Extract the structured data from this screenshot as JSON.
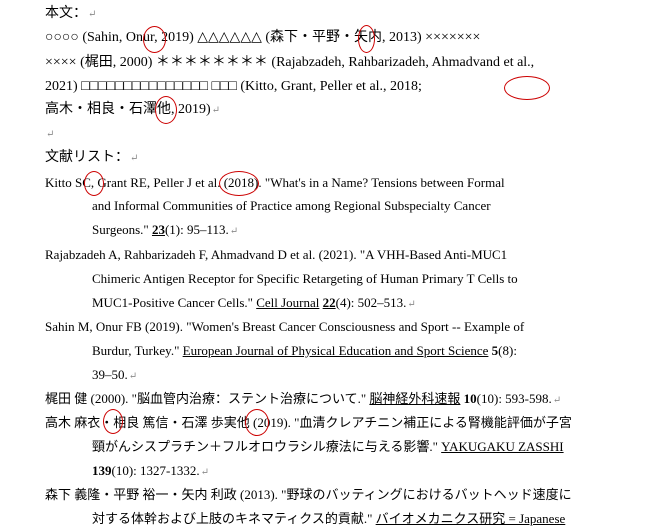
{
  "body": {
    "heading": "本文：",
    "lines": [
      "○○○○ (Sahin, Onur, 2019) △△△△△△ (森下・平野・矢内, 2013)  ×××××××",
      "×××× (梶田, 2000)  ＊＊＊＊＊＊＊＊ (Rajabzadeh, Rahbarizadeh, Ahmadvand et al.,",
      "2021) □□□□□□□□□□□□□□□  □□□ (Kitto, Grant, Peller et al., 2018;",
      "高木・相良・石澤他, 2019)"
    ]
  },
  "references": {
    "heading": "文献リスト：",
    "kitto": {
      "line1": "Kitto SC, Grant RE, Peller J et al. (2018). \"What's in a Name? Tensions between Formal",
      "line2": "and Informal Communities of Practice among Regional Subspecialty Cancer",
      "line3_pre": "Surgeons.\"  ",
      "line3_vol": "23",
      "line3_post": "(1): 95–113."
    },
    "rajab": {
      "line1": "Rajabzadeh A, Rahbarizadeh F, Ahmadvand D et al. (2021). \"A VHH-Based Anti-MUC1",
      "line2": "Chimeric Antigen Receptor for Specific Retargeting of Human Primary T Cells to",
      "line3_pre": "MUC1-Positive Cancer Cells.\" ",
      "line3_journal": "Cell Journal",
      "line3_vol": "22",
      "line3_post": "(4): 502–513."
    },
    "sahin": {
      "line1": "Sahin M, Onur FB (2019). \"Women's Breast Cancer Consciousness and Sport -- Example of",
      "line2_pre": "Burdur, Turkey.\" ",
      "line2_journal": "European Journal of Physical Education and Sport Science",
      "line2_vol": "5",
      "line2_post": "(8):",
      "line3": "39–50."
    },
    "kajita": {
      "pre": "梶田  健 (2000). \"脳血管内治療：ステント治療について.\" ",
      "journal": "脳神経外科速報",
      "vol": "10",
      "post": "(10): 593-598."
    },
    "takagi": {
      "line1": "高木  麻衣・相良  篤信・石澤  歩実他 (2019). \"血清クレアチニン補正による腎機能評価が子宮",
      "line2_pre": "頸がんシスプラチン＋フルオロウラシル療法に与える影響.\" ",
      "line2_journal": "YAKUGAKU ZASSHI",
      "line3_vol": "139",
      "line3_post": "(10): 1327-1332."
    },
    "morishita": {
      "line1": "森下  義隆・平野  裕一・矢内  利政 (2013). \"野球のバッティングにおけるバットヘッド速度に",
      "line2_pre": "対する体幹および上肢のキネマティクス的貢献.\" ",
      "line2_journal": "バイオメカニクス研究 = Japanese"
    }
  },
  "paragraph_mark": "↵",
  "colors": {
    "annotation": "#cc0000",
    "mark": "#8a8a8a"
  }
}
